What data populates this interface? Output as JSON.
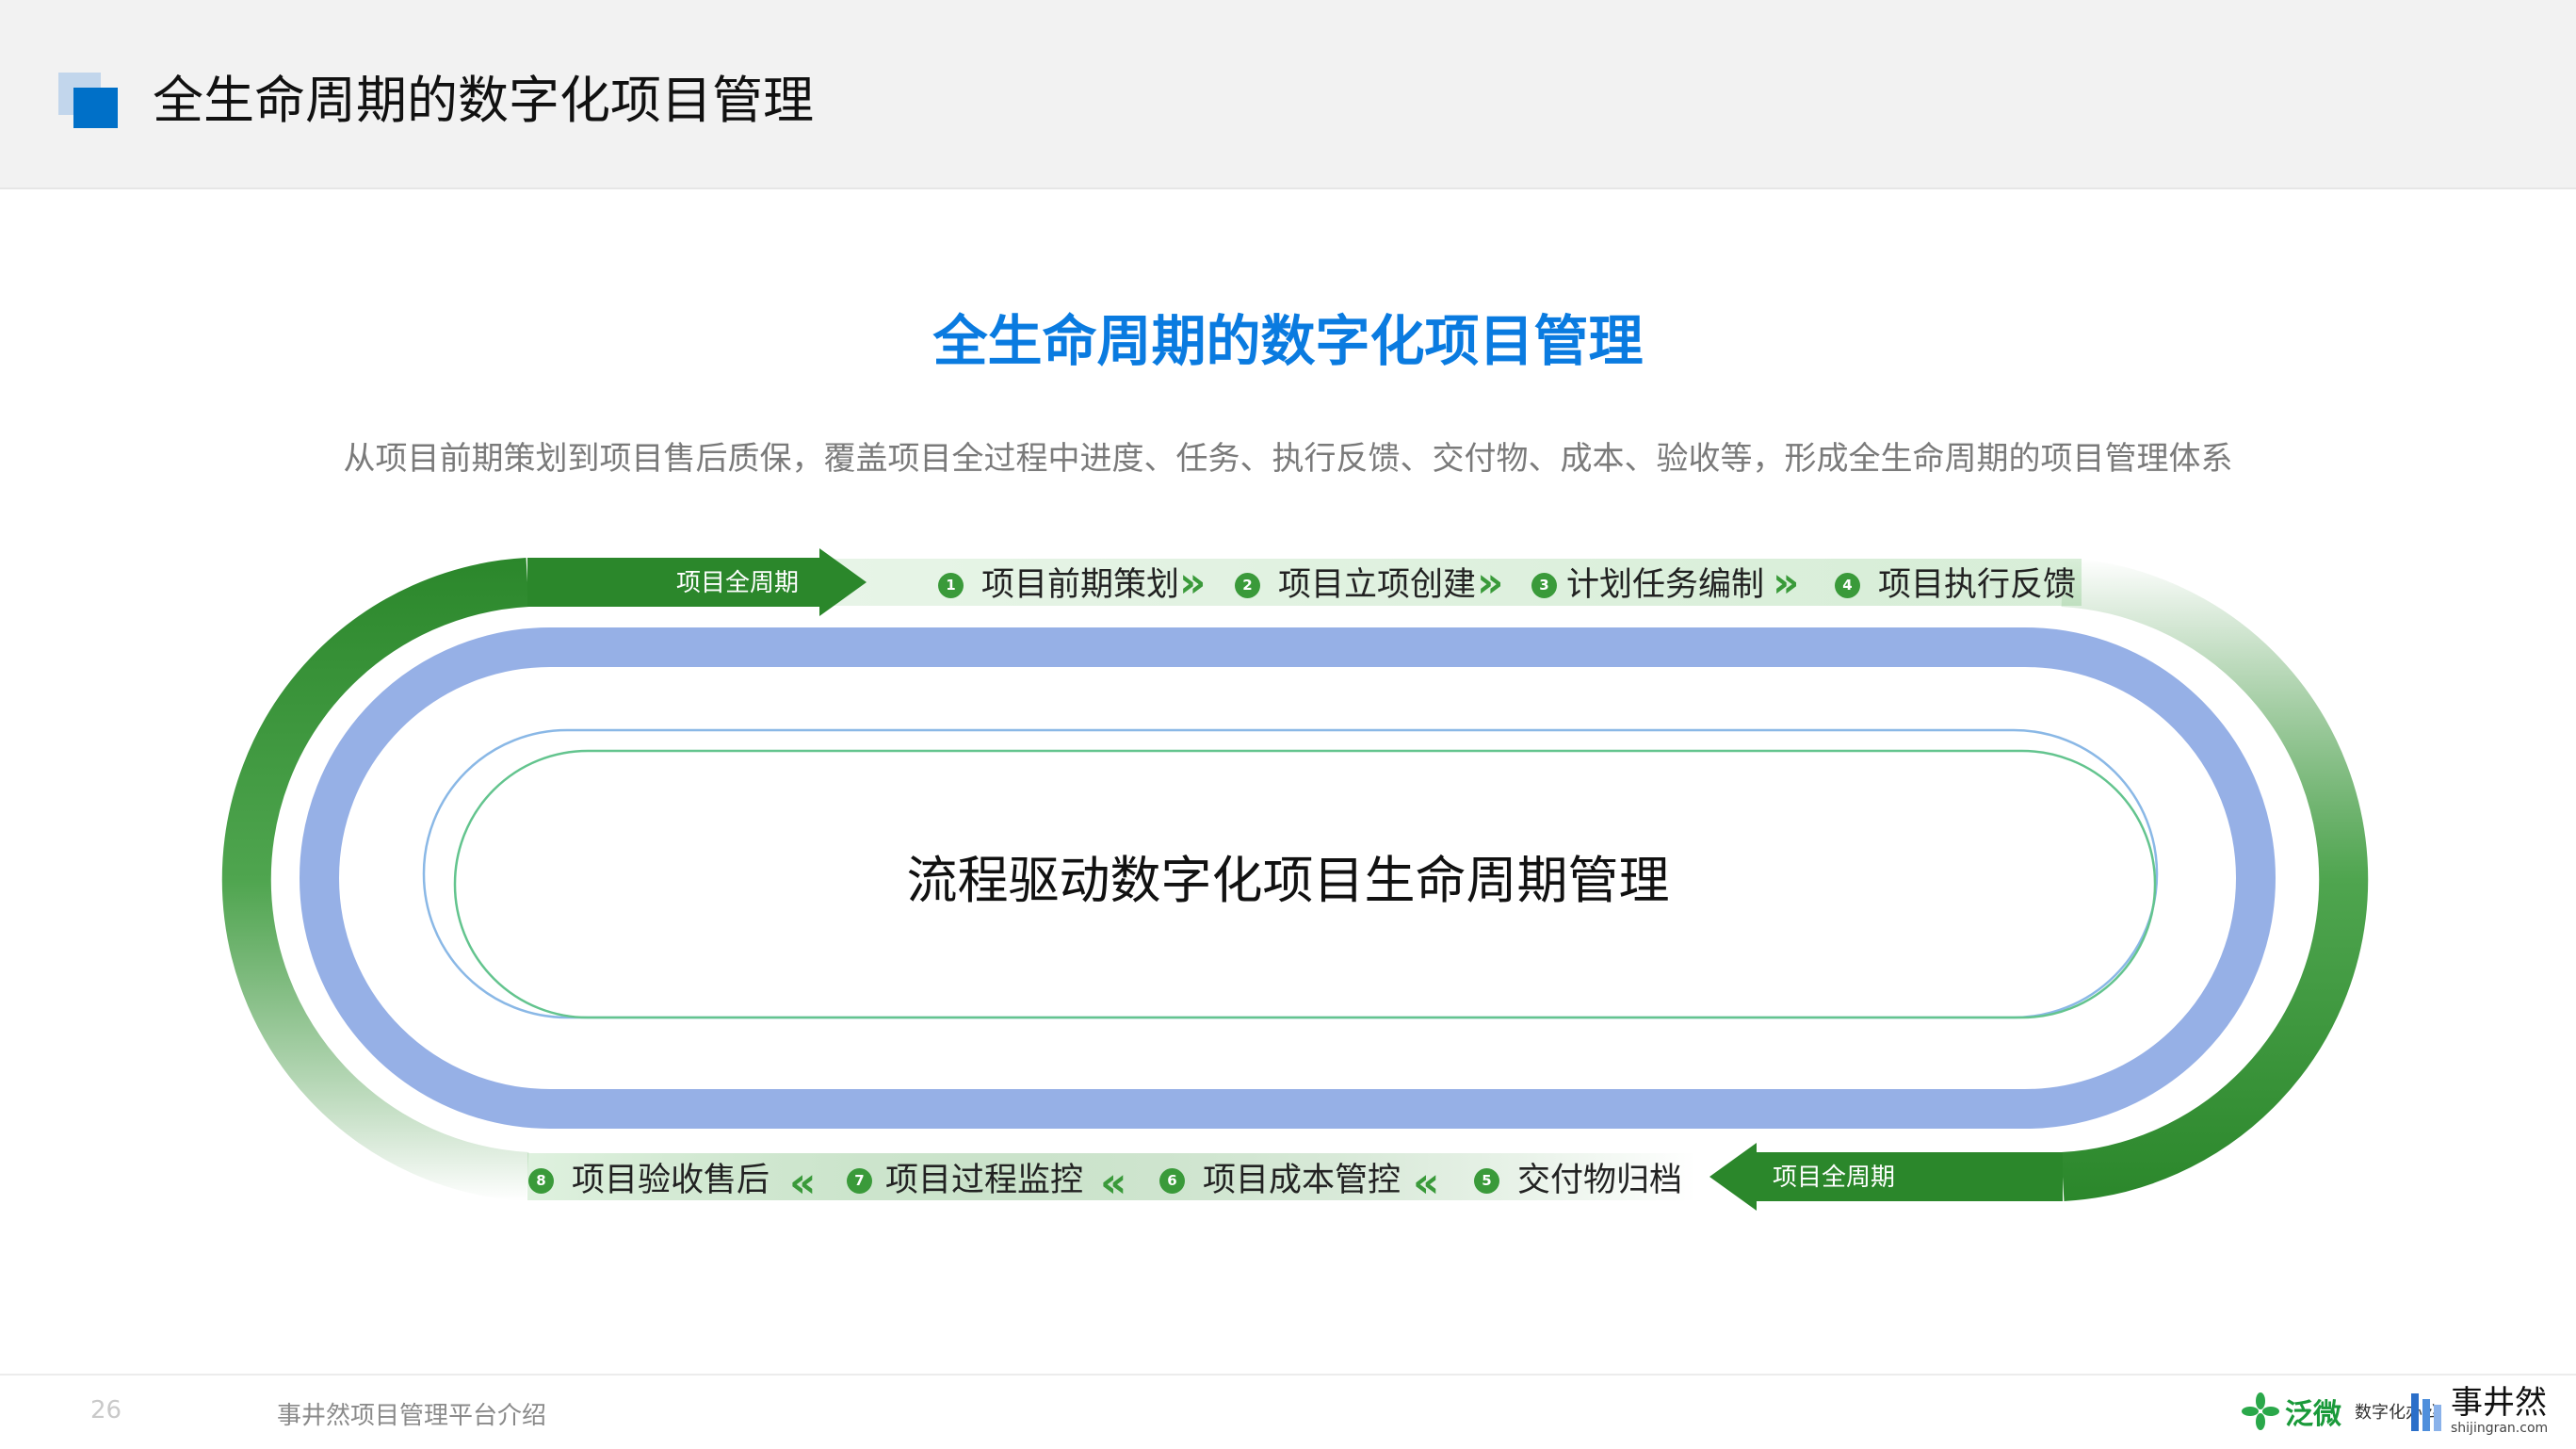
{
  "header": {
    "title": "全生命周期的数字化项目管理"
  },
  "main": {
    "title": "全生命周期的数字化项目管理",
    "subtitle": "从项目前期策划到项目售后质保，覆盖项目全过程中进度、任务、执行反馈、交付物、成本、验收等，形成全生命周期的项目管理体系",
    "center_text": "流程驱动数字化项目生命周期管理"
  },
  "cycle": {
    "top_arrow_label": "项目全周期",
    "bottom_arrow_label": "项目全周期",
    "steps": [
      {
        "num": "1",
        "label": "项目前期策划"
      },
      {
        "num": "2",
        "label": "项目立项创建"
      },
      {
        "num": "3",
        "label": "计划任务编制"
      },
      {
        "num": "4",
        "label": "项目执行反馈"
      },
      {
        "num": "5",
        "label": "交付物归档"
      },
      {
        "num": "6",
        "label": "项目成本管控"
      },
      {
        "num": "7",
        "label": "项目过程监控"
      },
      {
        "num": "8",
        "label": "项目验收售后"
      }
    ],
    "chevron_forward": "»",
    "chevron_back": "«"
  },
  "footer": {
    "page_number": "26",
    "text": "事井然项目管理平台介绍",
    "logo1_name": "泛微",
    "logo1_sub": "数字化办公",
    "logo2_name": "事井然",
    "logo2_url": "shijingran.com"
  },
  "colors": {
    "accent_blue": "#0a7be0",
    "green": "#2e8b2e",
    "track_blue": "#96b0e6"
  }
}
